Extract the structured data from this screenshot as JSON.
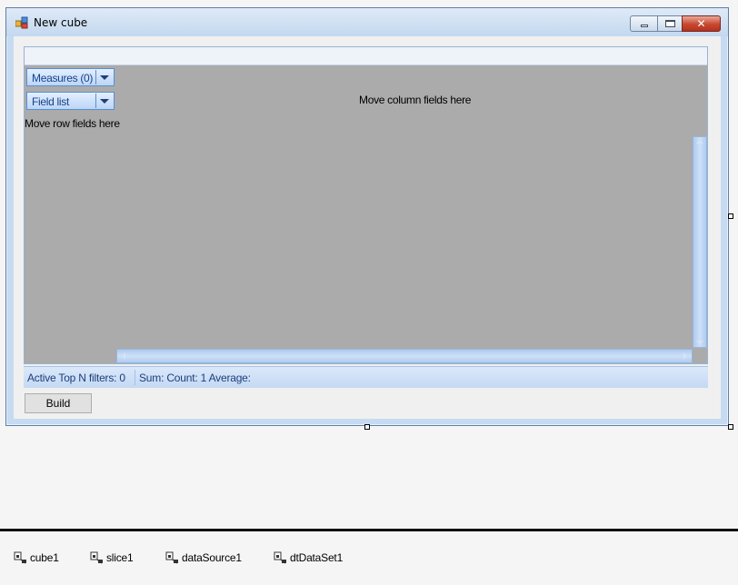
{
  "form": {
    "title": "New cube",
    "controls": {
      "minimize": "minimize",
      "maximize": "maximize",
      "close": "✕"
    }
  },
  "pivot": {
    "measures_label": "Measures (0)",
    "field_list_label": "Field list",
    "column_drop_text": "Move column fields here",
    "row_drop_text": "Move row fields here"
  },
  "status": {
    "filters": "Active Top N filters: 0",
    "aggregates": "Sum:  Count: 1 Average:"
  },
  "build_label": "Build",
  "tray": {
    "items": [
      {
        "label": "cube1",
        "icon": "component-icon"
      },
      {
        "label": "slice1",
        "icon": "component-icon"
      },
      {
        "label": "dataSource1",
        "icon": "component-icon"
      },
      {
        "label": "dtDataSet1",
        "icon": "component-icon"
      }
    ]
  },
  "colors": {
    "close_button": "#c7472f",
    "grid_background": "#ababab",
    "status_text": "#1c3e7a"
  }
}
